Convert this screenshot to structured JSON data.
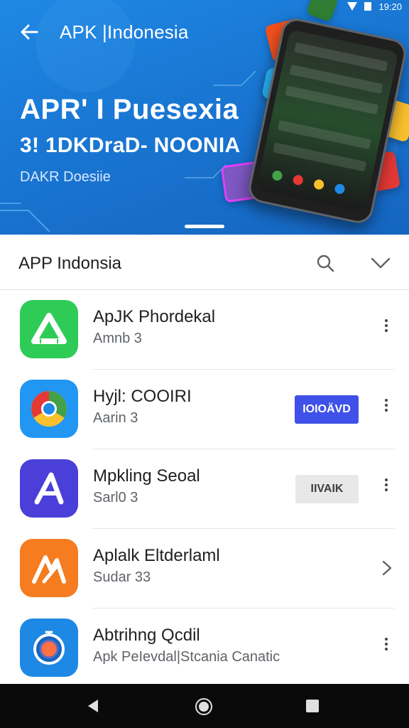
{
  "status_bar": {
    "time": "19:20"
  },
  "hero": {
    "app_title": "APK |Indonesia",
    "headline": "APR' I Puesexia",
    "subheadline": "3! 1DKDraD- NOONIA",
    "tagline": "DAKR Doesiie"
  },
  "section": {
    "title": "APP Indonsia"
  },
  "apps": [
    {
      "name": "ApJK Phordekal",
      "subtitle": "Amnb  3",
      "icon": "google-drive-style-icon",
      "icon_color": "#2ecc57",
      "action": "more"
    },
    {
      "name": "Hyjl: COOIRI",
      "subtitle": "Aarin  3",
      "icon": "chrome-style-icon",
      "icon_color": "#2196f3",
      "action": "install",
      "action_label": "IOIOÄVD"
    },
    {
      "name": "Mpkling Seoal",
      "subtitle": "Sarl0  3",
      "icon": "a-logo-icon",
      "icon_color": "#4a3fd8",
      "action": "open",
      "action_label": "IIVAIK"
    },
    {
      "name": "Aplalk Eltderlaml",
      "subtitle": "Sudar 33",
      "icon": "orange-logo-icon",
      "icon_color": "#f57c1f",
      "action": "chevron"
    },
    {
      "name": "Abtrihng Qcdil",
      "subtitle": "Apk PeIevdal|Stcania Canatic",
      "icon": "compass-icon",
      "icon_color": "#1e88e5",
      "action": "more"
    }
  ],
  "colors": {
    "hero_bg": "#1976d2",
    "install_button": "#3f51e8",
    "nav_bar": "#0a0a0a"
  }
}
